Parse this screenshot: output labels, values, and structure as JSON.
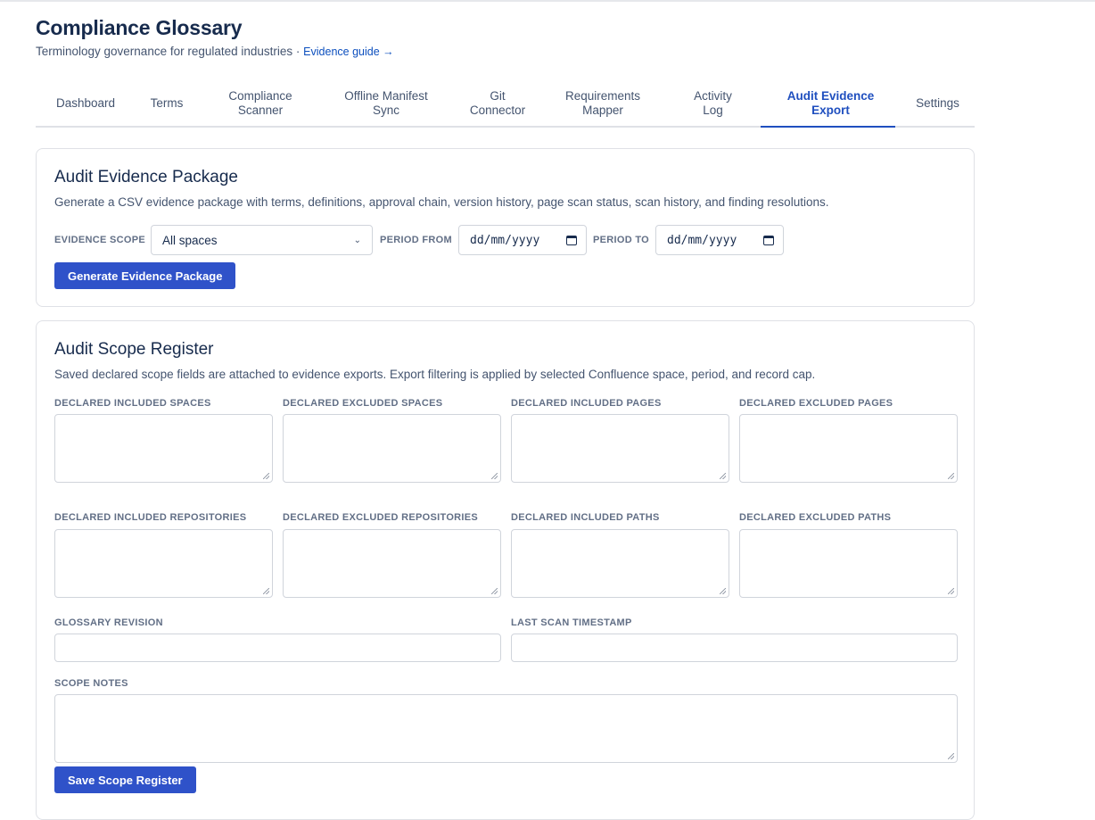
{
  "header": {
    "title": "Compliance Glossary",
    "subtitle": "Terminology governance for regulated industries · ",
    "guide_link": "Evidence guide →"
  },
  "tabs": [
    {
      "line1": "Dashboard",
      "line2": ""
    },
    {
      "line1": "Terms",
      "line2": ""
    },
    {
      "line1": "Compliance",
      "line2": "Scanner"
    },
    {
      "line1": "Offline Manifest",
      "line2": "Sync"
    },
    {
      "line1": "Git",
      "line2": "Connector"
    },
    {
      "line1": "Requirements",
      "line2": "Mapper"
    },
    {
      "line1": "Activity",
      "line2": "Log"
    },
    {
      "line1": "Audit Evidence",
      "line2": "Export"
    },
    {
      "line1": "Settings",
      "line2": ""
    }
  ],
  "active_tab": "Audit Evidence Export",
  "evidence_package": {
    "title": "Audit Evidence Package",
    "description": "Generate a CSV evidence package with terms, definitions, approval chain, version history, page scan status, scan history, and finding resolutions.",
    "scope_label": "EVIDENCE SCOPE",
    "scope_value": "All spaces",
    "period_from_label": "PERIOD FROM",
    "period_from_placeholder": "dd/mm/yyyy",
    "period_to_label": "PERIOD TO",
    "period_to_placeholder": "dd/mm/yyyy",
    "generate_button": "Generate Evidence Package"
  },
  "scope_register": {
    "title": "Audit Scope Register",
    "description": "Saved declared scope fields are attached to evidence exports. Export filtering is applied by selected Confluence space, period, and record cap.",
    "included_spaces_label": "DECLARED INCLUDED SPACES",
    "excluded_spaces_label": "DECLARED EXCLUDED SPACES",
    "included_pages_label": "DECLARED INCLUDED PAGES",
    "excluded_pages_label": "DECLARED EXCLUDED PAGES",
    "included_repos_label": "DECLARED INCLUDED REPOSITORIES",
    "excluded_repos_label": "DECLARED EXCLUDED REPOSITORIES",
    "included_paths_label": "DECLARED INCLUDED PATHS",
    "excluded_paths_label": "DECLARED EXCLUDED PATHS",
    "glossary_revision_label": "GLOSSARY REVISION",
    "last_scan_label": "LAST SCAN TIMESTAMP",
    "scope_notes_label": "SCOPE NOTES",
    "save_button": "Save Scope Register"
  },
  "colors": {
    "accent": "#1f4fbf",
    "button": "#2f52c9"
  }
}
